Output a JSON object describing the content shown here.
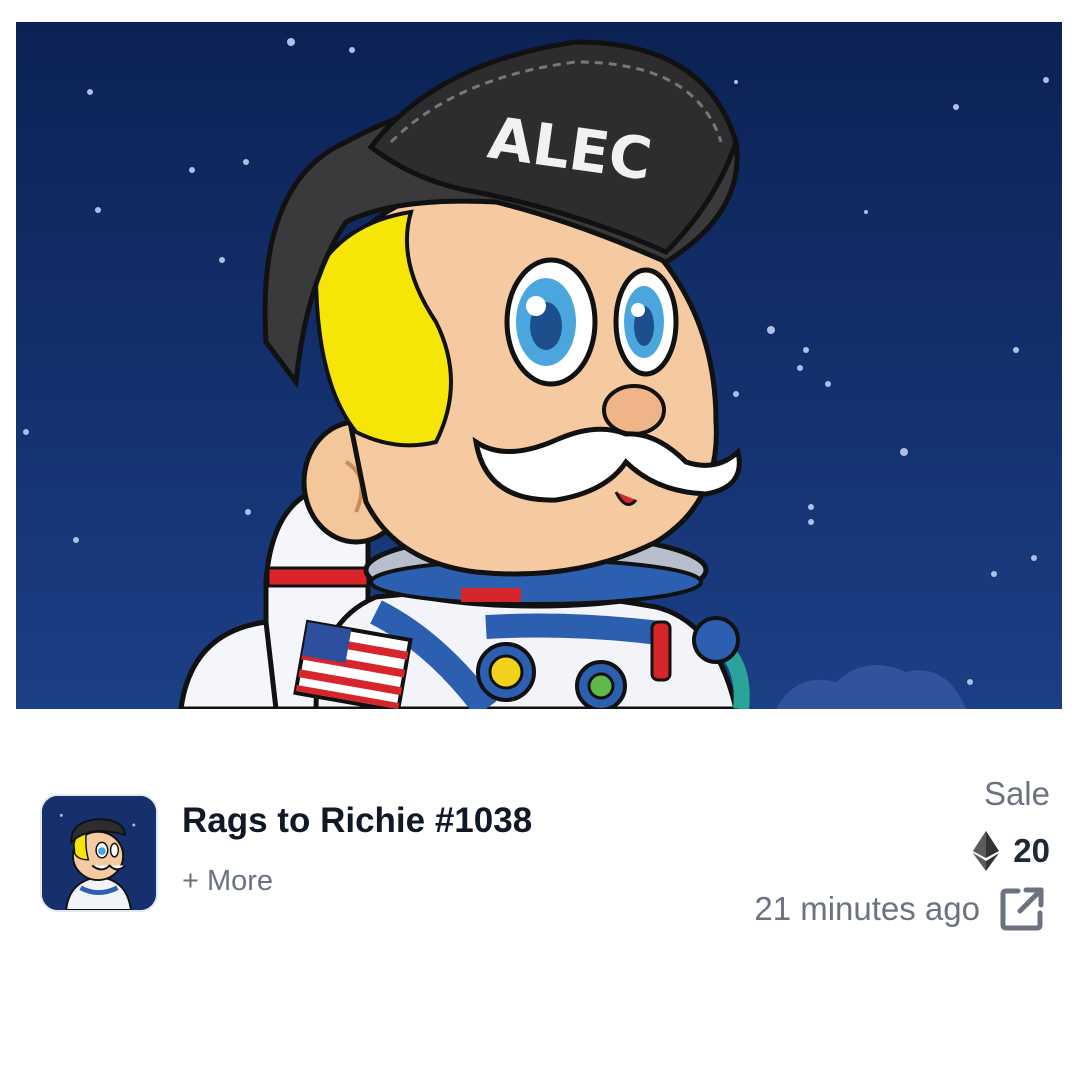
{
  "nft": {
    "title": "Rags to Richie #1038",
    "more_label": "+ More",
    "hat_text": "ALEC"
  },
  "sale": {
    "type_label": "Sale",
    "price": "20",
    "currency_icon": "ethereum-icon",
    "time_ago": "21 minutes ago",
    "link_icon": "external-link-icon"
  },
  "colors": {
    "title": "#111827",
    "muted": "#6b7280",
    "space_bg": "#14316f"
  }
}
